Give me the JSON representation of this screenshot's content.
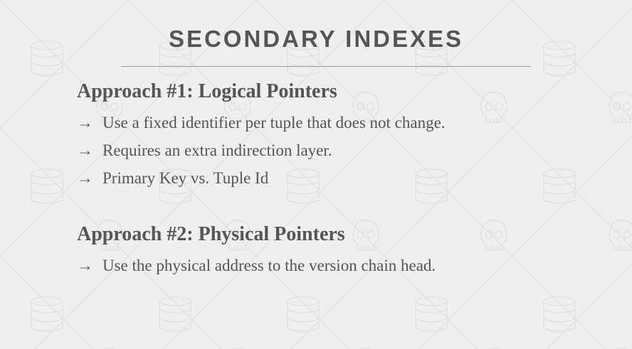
{
  "slide": {
    "title": "SECONDARY INDEXES",
    "sections": [
      {
        "heading": "Approach #1: Logical Pointers",
        "bullets": [
          "Use a fixed identifier per tuple that does not change.",
          "Requires an extra indirection layer.",
          "Primary Key vs. Tuple Id"
        ]
      },
      {
        "heading": "Approach #2: Physical Pointers",
        "bullets": [
          "Use the physical address to the version chain head."
        ]
      }
    ],
    "bullet_glyph": "→"
  },
  "colors": {
    "background": "#efefef",
    "text": "#555555",
    "rule": "#9a9a9a",
    "pattern": "#e2e2e2"
  },
  "background_icons": [
    "database-icon",
    "skull-icon"
  ]
}
